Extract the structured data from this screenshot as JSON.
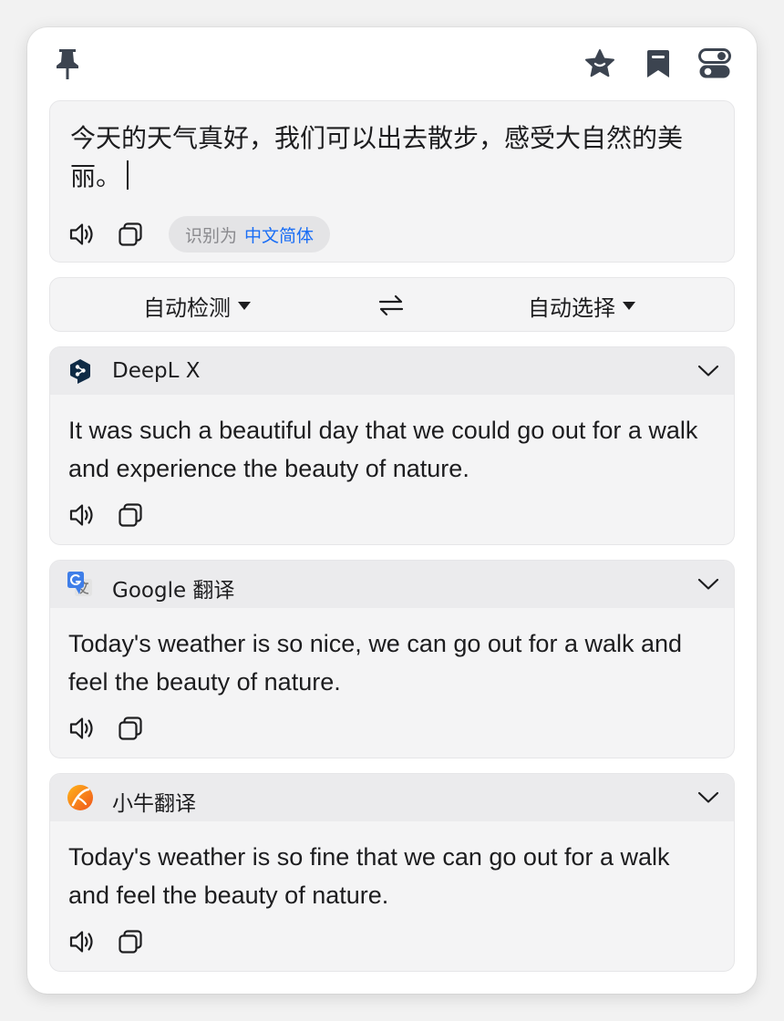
{
  "toolbar": {
    "pin_icon": "pin-icon",
    "star_icon": "star-icon",
    "bookmark_icon": "bookmark-icon",
    "toggle_icon": "toggle-settings-icon"
  },
  "input": {
    "text": "今天的天气真好，我们可以出去散步，感受大自然的美丽。",
    "detected_prefix": "识别为",
    "detected_language": "中文简体"
  },
  "languages": {
    "source": "自动检测",
    "target": "自动选择"
  },
  "results": [
    {
      "engine": "DeepL X",
      "icon": "deepl-icon",
      "text": "It was such a beautiful day that we could go out for a walk and experience the beauty of nature."
    },
    {
      "engine": "Google 翻译",
      "icon": "google-translate-icon",
      "text": "Today's weather is so nice, we can go out for a walk and feel the beauty of nature."
    },
    {
      "engine": "小牛翻译",
      "icon": "niutrans-icon",
      "text": "Today's weather is so fine that we can go out for a walk and feel the beauty of nature."
    }
  ],
  "colors": {
    "accent": "#1a6ef5",
    "icon": "#3c4450",
    "card_bg": "#f4f4f5",
    "card_header_bg": "#ebebed"
  }
}
